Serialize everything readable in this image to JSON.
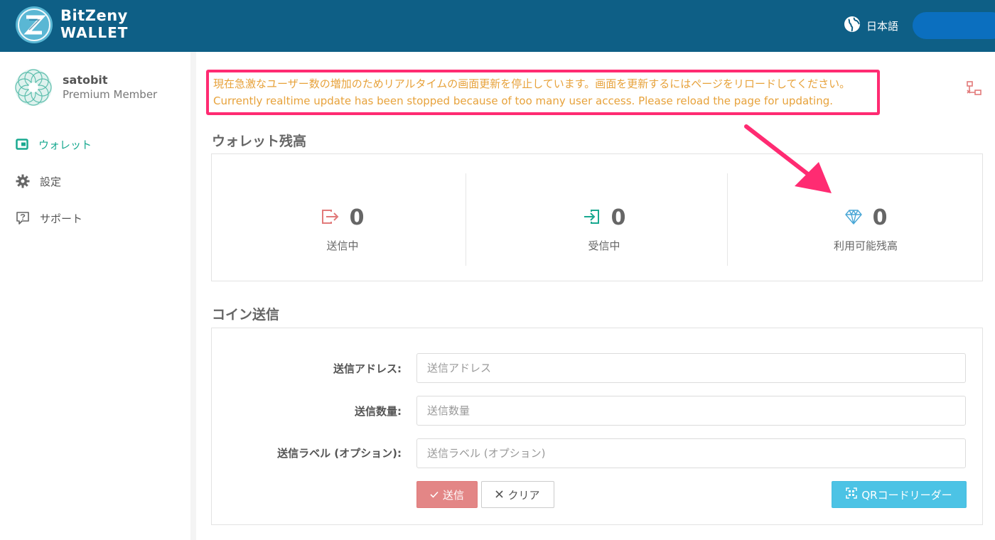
{
  "header": {
    "brand_line1": "BitZeny",
    "brand_line2": "WALLET",
    "language": "日本語"
  },
  "sidebar": {
    "username": "satobit",
    "membership": "Premium Member",
    "items": [
      {
        "label": "ウォレット",
        "icon": "wallet-icon"
      },
      {
        "label": "設定",
        "icon": "gear-icon"
      },
      {
        "label": "サポート",
        "icon": "help-icon"
      }
    ]
  },
  "alert": {
    "line_ja": "現在急激なユーザー数の増加のためリアルタイムの画面更新を停止しています。画面を更新するにはページをリロードしてください。",
    "line_en": "Currently realtime update has been stopped because of too many user access. Please reload the page for updating."
  },
  "balance": {
    "title": "ウォレット残高",
    "stats": [
      {
        "value": "0",
        "label": "送信中",
        "icon": "send-out-icon"
      },
      {
        "value": "0",
        "label": "受信中",
        "icon": "receive-in-icon"
      },
      {
        "value": "0",
        "label": "利用可能残高",
        "icon": "diamond-icon"
      }
    ]
  },
  "send": {
    "title": "コイン送信",
    "address_label": "送信アドレス:",
    "address_placeholder": "送信アドレス",
    "amount_label": "送信数量:",
    "amount_placeholder": "送信数量",
    "memo_label": "送信ラベル (オプション):",
    "memo_placeholder": "送信ラベル (オプション)",
    "send_button": "送信",
    "clear_button": "クリア",
    "qr_button": "QRコードリーダー"
  },
  "colors": {
    "header_bg": "#0e5f86",
    "accent_teal": "#19a990",
    "alert_border": "#ff2b72",
    "alert_text": "#e7a23b",
    "send_button": "#e38686",
    "qr_button": "#4cc3e5"
  }
}
